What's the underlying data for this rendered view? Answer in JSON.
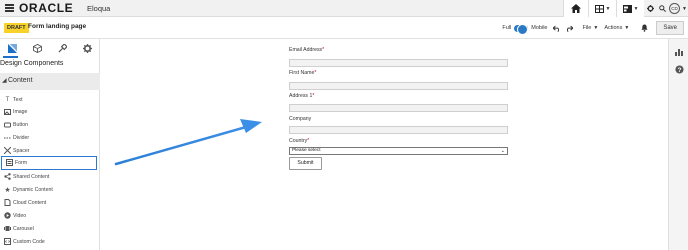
{
  "brand": {
    "oracle": "ORACLE",
    "product": "Eloqua"
  },
  "topbar": {
    "icons": [
      "home-icon",
      "grid-icon",
      "assets-icon",
      "gear-icon",
      "search-icon"
    ],
    "avatar_initials": "CD"
  },
  "editor": {
    "status_badge": "DRAFT",
    "title": "Form landing page",
    "view_full": "Full",
    "view_mobile": "Mobile",
    "file_menu": "File",
    "actions_menu": "Actions",
    "save_label": "Save"
  },
  "panel": {
    "title": "Design Components",
    "section_header": "Content",
    "tabs": [
      "design-tab",
      "cube-tab",
      "paint-tab",
      "settings-tab"
    ],
    "items": [
      {
        "label": "Text",
        "icon": "text-icon"
      },
      {
        "label": "Image",
        "icon": "image-icon"
      },
      {
        "label": "Button",
        "icon": "button-icon"
      },
      {
        "label": "Divider",
        "icon": "divider-icon"
      },
      {
        "label": "Spacer",
        "icon": "spacer-icon"
      },
      {
        "label": "Form",
        "icon": "form-icon"
      },
      {
        "label": "Shared Content",
        "icon": "shared-icon"
      },
      {
        "label": "Dynamic Content",
        "icon": "star-icon"
      },
      {
        "label": "Cloud Content",
        "icon": "cloud-icon"
      },
      {
        "label": "Video",
        "icon": "video-icon"
      },
      {
        "label": "Carousel",
        "icon": "carousel-icon"
      },
      {
        "label": "Custom Code",
        "icon": "code-icon"
      }
    ]
  },
  "form": {
    "fields": [
      {
        "label": "Email Address",
        "required": "*"
      },
      {
        "label": "First Name",
        "required": "*"
      },
      {
        "label": "Address 1",
        "required": "*"
      },
      {
        "label": "Company",
        "required": ""
      },
      {
        "label": "Country",
        "required": "*"
      }
    ],
    "country_placeholder": "Please select",
    "submit_label": "Submit"
  },
  "colors": {
    "accent_blue": "#2979c5",
    "draft_yellow": "#f6d22b",
    "required_red": "#d0021b"
  }
}
